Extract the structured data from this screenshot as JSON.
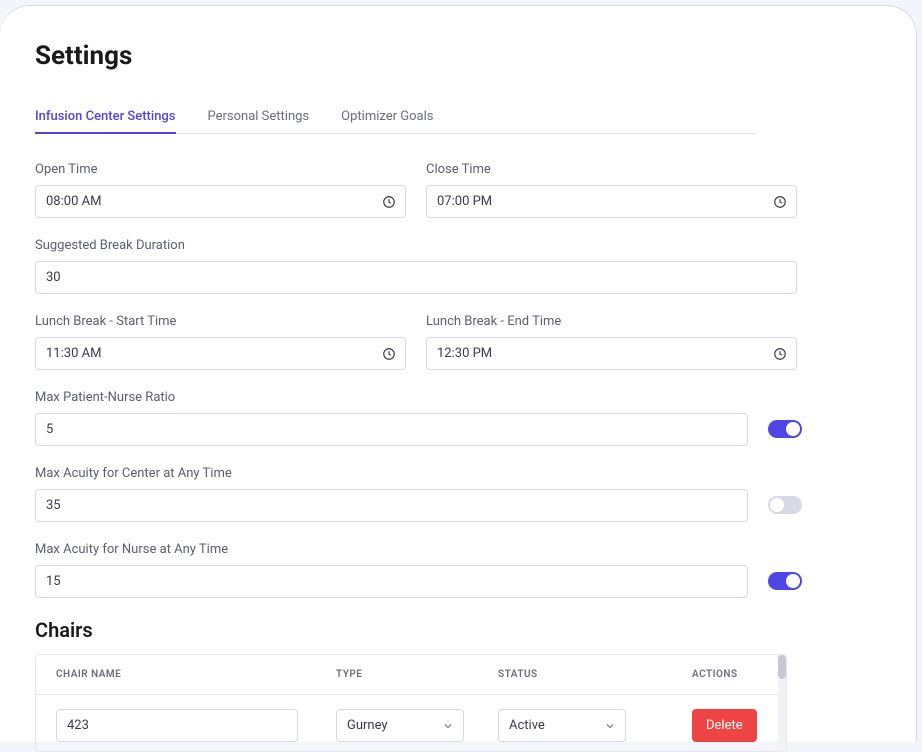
{
  "page": {
    "title": "Settings"
  },
  "tabs": [
    {
      "label": "Infusion Center Settings",
      "active": true
    },
    {
      "label": "Personal Settings",
      "active": false
    },
    {
      "label": "Optimizer Goals",
      "active": false
    }
  ],
  "fields": {
    "open_time": {
      "label": "Open Time",
      "value": "08:00 AM"
    },
    "close_time": {
      "label": "Close Time",
      "value": "07:00 PM"
    },
    "break_duration": {
      "label": "Suggested Break Duration",
      "value": "30"
    },
    "lunch_start": {
      "label": "Lunch Break - Start Time",
      "value": "11:30 AM"
    },
    "lunch_end": {
      "label": "Lunch Break - End Time",
      "value": "12:30 PM"
    },
    "nurse_ratio": {
      "label": "Max Patient-Nurse Ratio",
      "value": "5",
      "toggle_on": true
    },
    "center_acuity": {
      "label": "Max Acuity for Center at Any Time",
      "value": "35",
      "toggle_on": false
    },
    "nurse_acuity": {
      "label": "Max Acuity for Nurse at Any Time",
      "value": "15",
      "toggle_on": true
    }
  },
  "chairs_section": {
    "title": "Chairs"
  },
  "chairs_table": {
    "headers": {
      "name": "CHAIR NAME",
      "type": "TYPE",
      "status": "STATUS",
      "actions": "ACTIONS"
    },
    "rows": [
      {
        "name": "423",
        "type": "Gurney",
        "status": "Active",
        "delete_label": "Delete"
      }
    ]
  }
}
